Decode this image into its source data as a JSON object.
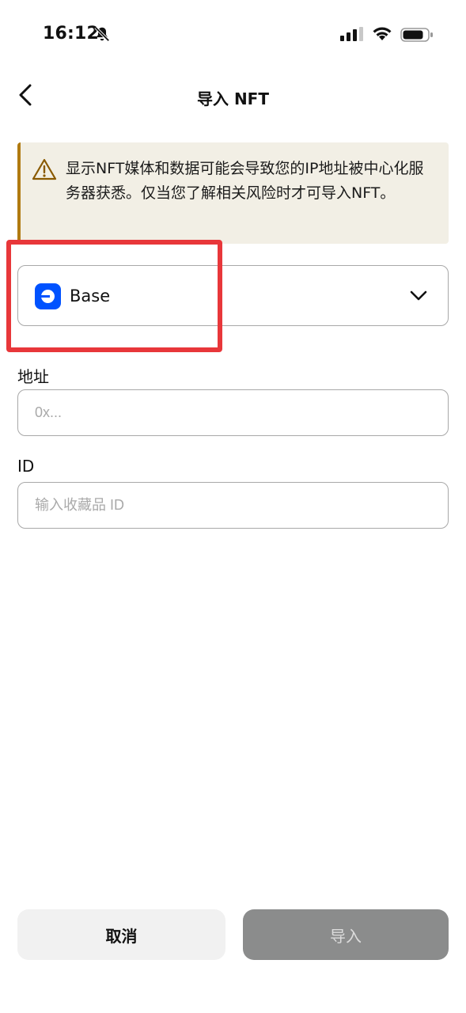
{
  "status_bar": {
    "time": "16:12"
  },
  "header": {
    "title": "导入 NFT"
  },
  "warning": {
    "text": "显示NFT媒体和数据可能会导致您的IP地址被中心化服务器获悉。仅当您了解相关风险时才可导入NFT。"
  },
  "network_select": {
    "selected": "Base",
    "icon": "base-logo"
  },
  "address_field": {
    "label": "地址",
    "placeholder": "0x..."
  },
  "id_field": {
    "label": "ID",
    "placeholder": "输入收藏品 ID"
  },
  "actions": {
    "cancel_label": "取消",
    "import_label": "导入"
  },
  "colors": {
    "accent_base": "#0052ff",
    "warning_bg": "#f2efe5",
    "warning_border": "#b07a10",
    "highlight": "#e8373a",
    "disabled_button": "#8b8c8c"
  }
}
